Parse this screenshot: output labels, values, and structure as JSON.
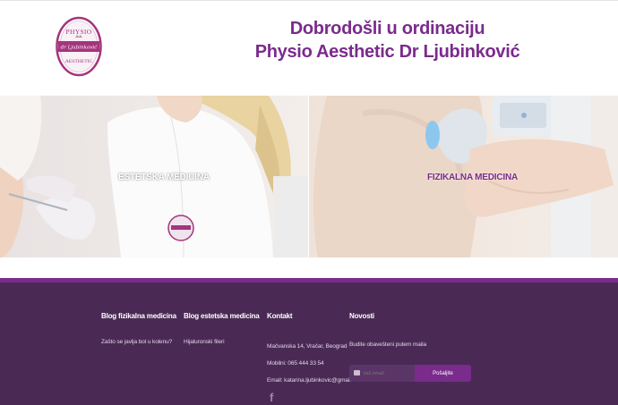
{
  "header": {
    "logo": {
      "top_text": "PHYSIO",
      "middle_text": "dr Ljubinković",
      "bottom_text": "AESTHETIC"
    },
    "welcome_line1": "Dobrodošli u ordinaciju",
    "welcome_line2": "Physio Aesthetic Dr Ljubinković"
  },
  "hero": {
    "left_label": "ESTETSKA MEDICINA",
    "right_label": "FIZIKALNA MEDICINA"
  },
  "footer": {
    "col1": {
      "heading": "Blog fizikalna medicina",
      "link1": "Zašto se javlja bol u kolenu?"
    },
    "col2": {
      "heading": "Blog estetska medicina",
      "link1": "Hijaluronski fileri"
    },
    "col3": {
      "heading": "Kontakt",
      "address": "Mačvanska 14, Vračar, Beograd",
      "phone": "Mobilni: 065 444 33 54",
      "email": "Email: katarina.ljubinkovic@gmail.com"
    },
    "col4": {
      "heading": "Novosti",
      "subtitle": "Budite obavešteni putem maila",
      "email_placeholder": "Vaš email",
      "send_label": "Pošaljite"
    },
    "facebook_icon_glyph": "f"
  },
  "colors": {
    "brand_purple": "#7a2b8c",
    "footer_bg": "#4a2a55"
  }
}
